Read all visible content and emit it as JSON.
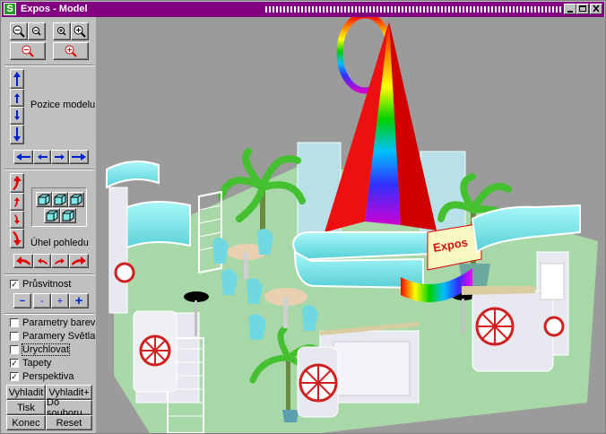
{
  "window": {
    "title": "Expos - Model",
    "app_icon_letter": "S"
  },
  "panel": {
    "model_position_label": "Pozice modelu",
    "view_angle_label": "Úhel pohledu",
    "transparency_label": "Průsvitnost",
    "transparency_checked": true,
    "stepper_minus": "−",
    "stepper_minus_small": "-",
    "stepper_plus_small": "+",
    "stepper_plus": "+",
    "options": [
      {
        "label": "Parametry barev",
        "checked": false
      },
      {
        "label": "Paramery Světla",
        "checked": false
      },
      {
        "label": "Urychlovat",
        "checked": false
      },
      {
        "label": "Tapety",
        "checked": true
      },
      {
        "label": "Perspektiva",
        "checked": true
      }
    ],
    "buttons": {
      "smooth": "Vyhladit",
      "smooth_plus": "Vyhladit+",
      "print": "Tisk",
      "to_file": "Do souboru",
      "end": "Konec",
      "reset": "Reset"
    }
  },
  "scene": {
    "sign_text": "Expos",
    "background_color": "#9b9b9b",
    "floor_color": "#a8d8a8",
    "panel_color": "#7fe8e8"
  }
}
